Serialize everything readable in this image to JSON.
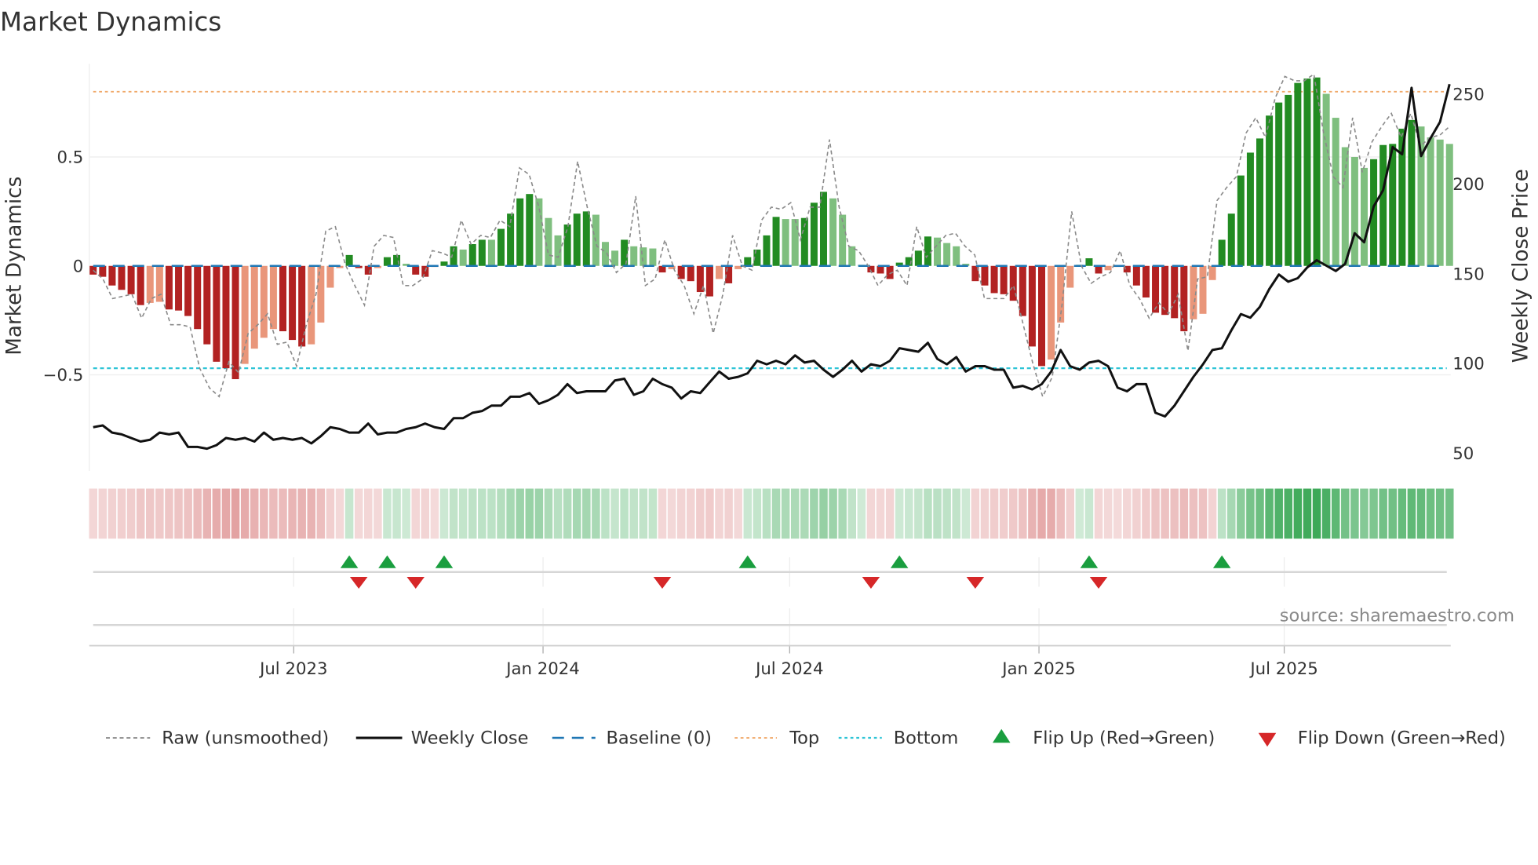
{
  "title": "Market Dynamics",
  "chart_data": {
    "type": "bar",
    "title": "Market Dynamics",
    "ylabel": "Market Dynamics",
    "y2label": "Weekly Close Price",
    "x_start": "2023-02-03",
    "x_step_days": 7,
    "x_ticks": [
      {
        "label": "Jul 2023",
        "date": "2023-07-01"
      },
      {
        "label": "Jan 2024",
        "date": "2024-01-01"
      },
      {
        "label": "Jul 2024",
        "date": "2024-07-01"
      },
      {
        "label": "Jan 2025",
        "date": "2025-01-01"
      },
      {
        "label": "Jul 2025",
        "date": "2025-07-01"
      }
    ],
    "y_ticks": [
      {
        "label": "0.5",
        "value": 0.5
      },
      {
        "label": "0",
        "value": 0
      },
      {
        "label": "−0.5",
        "value": -0.5
      }
    ],
    "y2_ticks": [
      {
        "label": "250",
        "value": 250
      },
      {
        "label": "200",
        "value": 200
      },
      {
        "label": "150",
        "value": 150
      },
      {
        "label": "100",
        "value": 100
      },
      {
        "label": "50",
        "value": 50
      }
    ],
    "ylim": [
      -0.94,
      0.93
    ],
    "y2lim": [
      40,
      266
    ],
    "grid": true,
    "reference_lines": {
      "baseline": 0,
      "top": 0.8,
      "bottom": -0.47
    },
    "series": [
      {
        "name": "Market Dynamics (smoothed)",
        "kind": "bar",
        "values": [
          -0.04,
          -0.05,
          -0.09,
          -0.11,
          -0.13,
          -0.18,
          -0.17,
          -0.165,
          -0.2,
          -0.205,
          -0.23,
          -0.29,
          -0.36,
          -0.44,
          -0.47,
          -0.52,
          -0.45,
          -0.38,
          -0.33,
          -0.29,
          -0.3,
          -0.34,
          -0.37,
          -0.36,
          -0.26,
          -0.1,
          -0.01,
          0.05,
          -0.01,
          -0.04,
          -0.01,
          0.04,
          0.05,
          0.01,
          -0.04,
          -0.05,
          -0.005,
          0.02,
          0.09,
          0.075,
          0.1,
          0.12,
          0.12,
          0.17,
          0.24,
          0.31,
          0.33,
          0.31,
          0.22,
          0.14,
          0.19,
          0.24,
          0.25,
          0.235,
          0.11,
          0.07,
          0.12,
          0.09,
          0.085,
          0.08,
          -0.03,
          -0.015,
          -0.06,
          -0.07,
          -0.12,
          -0.14,
          -0.06,
          -0.08,
          -0.015,
          0.04,
          0.075,
          0.14,
          0.225,
          0.215,
          0.215,
          0.22,
          0.29,
          0.34,
          0.31,
          0.235,
          0.09,
          0.005,
          -0.03,
          -0.035,
          -0.06,
          0.015,
          0.04,
          0.07,
          0.135,
          0.13,
          0.105,
          0.09,
          0.01,
          -0.07,
          -0.09,
          -0.125,
          -0.13,
          -0.16,
          -0.23,
          -0.37,
          -0.46,
          -0.43,
          -0.26,
          -0.1,
          0.005,
          0.035,
          -0.035,
          -0.02,
          -0.005,
          -0.03,
          -0.09,
          -0.145,
          -0.215,
          -0.225,
          -0.24,
          -0.3,
          -0.245,
          -0.22,
          -0.065,
          0.12,
          0.24,
          0.415,
          0.52,
          0.585,
          0.69,
          0.75,
          0.785,
          0.84,
          0.86,
          0.865,
          0.79,
          0.68,
          0.545,
          0.5,
          0.45,
          0.49,
          0.555,
          0.56,
          0.63,
          0.67,
          0.64,
          0.59,
          0.58,
          0.56
        ]
      },
      {
        "name": "Raw (unsmoothed)",
        "kind": "line",
        "values": [
          -0.02,
          -0.06,
          -0.15,
          -0.14,
          -0.13,
          -0.24,
          -0.15,
          -0.13,
          -0.27,
          -0.27,
          -0.28,
          -0.47,
          -0.56,
          -0.6,
          -0.44,
          -0.49,
          -0.31,
          -0.27,
          -0.22,
          -0.36,
          -0.35,
          -0.46,
          -0.27,
          -0.13,
          0.16,
          0.18,
          0.01,
          -0.09,
          -0.18,
          0.09,
          0.14,
          0.13,
          -0.09,
          -0.09,
          -0.06,
          0.07,
          0.06,
          0.04,
          0.21,
          0.1,
          0.14,
          0.13,
          0.21,
          0.18,
          0.45,
          0.42,
          0.27,
          0.05,
          0.04,
          0.18,
          0.48,
          0.27,
          0.09,
          0.06,
          -0.03,
          0.01,
          0.32,
          -0.09,
          -0.06,
          0.12,
          -0.02,
          -0.09,
          -0.22,
          -0.09,
          -0.31,
          -0.13,
          0.14,
          0.0,
          -0.02,
          0.21,
          0.27,
          0.26,
          0.29,
          0.12,
          0.27,
          0.27,
          0.58,
          0.27,
          0.09,
          0.07,
          0.0,
          -0.09,
          -0.04,
          -0.02,
          -0.09,
          0.18,
          0.04,
          0.09,
          0.14,
          0.15,
          0.09,
          0.05,
          -0.15,
          -0.15,
          -0.15,
          -0.09,
          -0.27,
          -0.45,
          -0.6,
          -0.51,
          -0.18,
          0.25,
          0.0,
          -0.08,
          -0.05,
          -0.03,
          0.07,
          -0.09,
          -0.15,
          -0.24,
          -0.17,
          -0.22,
          -0.13,
          -0.39,
          -0.06,
          -0.05,
          0.3,
          0.36,
          0.41,
          0.61,
          0.68,
          0.59,
          0.77,
          0.87,
          0.85,
          0.85,
          0.88,
          0.61,
          0.41,
          0.36,
          0.68,
          0.43,
          0.57,
          0.64,
          0.7,
          0.59,
          0.7,
          0.55,
          0.59,
          0.6,
          0.64
        ]
      },
      {
        "name": "Weekly Close",
        "kind": "line",
        "axis": "right",
        "values": [
          64,
          65,
          61,
          60,
          58,
          56,
          57,
          61,
          60,
          61,
          53,
          53,
          52,
          54,
          58,
          57,
          58,
          56,
          61,
          57,
          58,
          57,
          58,
          55,
          59,
          64,
          63,
          61,
          61,
          66,
          60,
          61,
          61,
          63,
          64,
          66,
          64,
          63,
          69,
          69,
          72,
          73,
          76,
          76,
          81,
          81,
          83,
          77,
          79,
          82,
          88,
          83,
          84,
          84,
          84,
          90,
          91,
          82,
          84,
          91,
          88,
          86,
          80,
          84,
          83,
          89,
          95,
          91,
          92,
          94,
          101,
          99,
          101,
          99,
          104,
          100,
          101,
          96,
          92,
          96,
          101,
          95,
          99,
          98,
          101,
          108,
          107,
          106,
          111,
          102,
          99,
          103,
          95,
          98,
          98,
          96,
          96,
          86,
          87,
          85,
          88,
          95,
          107,
          98,
          96,
          100,
          101,
          98,
          86,
          84,
          88,
          88,
          72,
          70,
          76,
          84,
          92,
          99,
          107,
          108,
          118,
          127,
          125,
          131,
          141,
          149,
          145,
          147,
          153,
          157,
          154,
          151,
          155,
          172,
          167,
          187,
          196,
          220,
          216,
          253,
          215,
          225,
          234,
          255
        ]
      }
    ],
    "flip_up_weeks": [
      28,
      32,
      38,
      70,
      86,
      106,
      120
    ],
    "flip_down_weeks": [
      29,
      35,
      61,
      83,
      94,
      107
    ],
    "legend_position": "bottom",
    "legend": [
      {
        "label": "Raw (unsmoothed)",
        "key": "raw"
      },
      {
        "label": "Weekly Close",
        "key": "close"
      },
      {
        "label": "Baseline (0)",
        "key": "baseline"
      },
      {
        "label": "Top",
        "key": "top"
      },
      {
        "label": "Bottom",
        "key": "bottom"
      },
      {
        "label": "Flip Up (Red→Green)",
        "key": "flipup"
      },
      {
        "label": "Flip Down (Green→Red)",
        "key": "flipdown"
      }
    ],
    "colors": {
      "bar_red_strong": "#b22222",
      "bar_red_weak": "#e9967a",
      "bar_green_strong": "#228b22",
      "bar_green_weak": "#7fbf7f",
      "raw": "#8a8a8a",
      "close": "#111111",
      "baseline": "#1f77b4",
      "top": "#f0a868",
      "bottom": "#2ec4d6",
      "flip_up": "#1a9e3f",
      "flip_down": "#d62728"
    }
  },
  "source": "source: sharemaestro.com"
}
